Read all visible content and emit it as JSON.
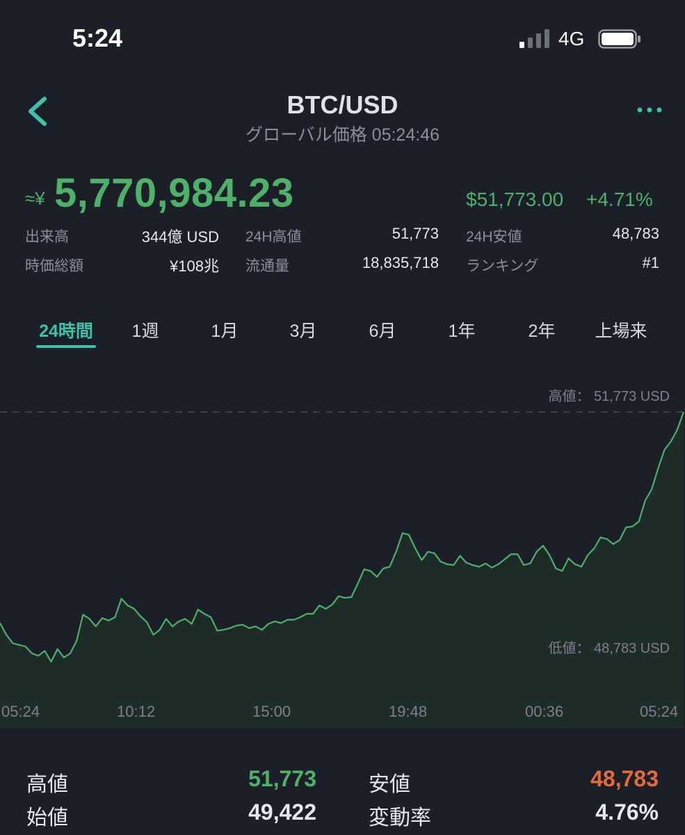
{
  "status_bar": {
    "time": "5:24",
    "network": "4G"
  },
  "header": {
    "title": "BTC/USD",
    "subtitle": "グローバル価格 05:24:46"
  },
  "price": {
    "approx_prefix": "≈¥",
    "jpy": "5,770,984.23",
    "usd": "$51,773.00",
    "change": "+4.71%"
  },
  "stats": {
    "volume_label": "出来高",
    "volume": "344億 USD",
    "high24_label": "24H高値",
    "high24": "51,773",
    "low24_label": "24H安値",
    "low24": "48,783",
    "mcap_label": "時価総額",
    "mcap": "¥108兆",
    "supply_label": "流通量",
    "supply": "18,835,718",
    "rank_label": "ランキング",
    "rank": "#1"
  },
  "tabs": [
    "24時間",
    "1週",
    "1月",
    "3月",
    "6月",
    "1年",
    "2年",
    "上場来"
  ],
  "active_tab": 0,
  "chart": {
    "high_label": "高値：  51,773 USD",
    "low_label": "低値：  48,783 USD"
  },
  "chart_data": {
    "type": "area",
    "title": "",
    "x_ticks": [
      "05:24",
      "10:12",
      "15:00",
      "19:48",
      "00:36",
      "05:24"
    ],
    "high": 51773,
    "low": 48783,
    "ylim": [
      48783,
      51773
    ],
    "series": [
      {
        "values": [
          49260,
          49120,
          49020,
          49000,
          48980,
          48900,
          48870,
          48930,
          48800,
          48950,
          48850,
          48900,
          49050,
          49360,
          49310,
          49220,
          49320,
          49290,
          49330,
          49550,
          49470,
          49430,
          49340,
          49270,
          49120,
          49180,
          49310,
          49220,
          49280,
          49310,
          49250,
          49420,
          49370,
          49330,
          49170,
          49180,
          49200,
          49230,
          49240,
          49200,
          49220,
          49180,
          49250,
          49280,
          49260,
          49300,
          49300,
          49330,
          49370,
          49370,
          49470,
          49430,
          49480,
          49580,
          49560,
          49570,
          49730,
          49900,
          49880,
          49810,
          49910,
          49930,
          50110,
          50330,
          50310,
          50150,
          50010,
          50110,
          50090,
          49990,
          49960,
          49950,
          50060,
          49980,
          49950,
          49930,
          49970,
          49920,
          49960,
          50020,
          50080,
          50080,
          49950,
          49970,
          50110,
          50180,
          50070,
          49910,
          49880,
          50030,
          49960,
          49930,
          50070,
          50150,
          50280,
          50260,
          50200,
          50250,
          50400,
          50410,
          50470,
          50720,
          50850,
          51100,
          51320,
          51420,
          51560,
          51773
        ]
      }
    ],
    "fill_color": "#1f2b29",
    "line_color": "#4fb06a",
    "gridlines_dashed_at": [
      "high",
      "low"
    ]
  },
  "summary": {
    "open_high_label": "高値",
    "open_high": "51,773",
    "low_label": "安値",
    "low": "48,783",
    "open_label": "始値",
    "open": "49,422",
    "vol_label": "変動率",
    "vol": "4.76%"
  },
  "colors": {
    "up": "#4fb06a",
    "down": "#e36b3f",
    "accent": "#3fc0a8"
  }
}
